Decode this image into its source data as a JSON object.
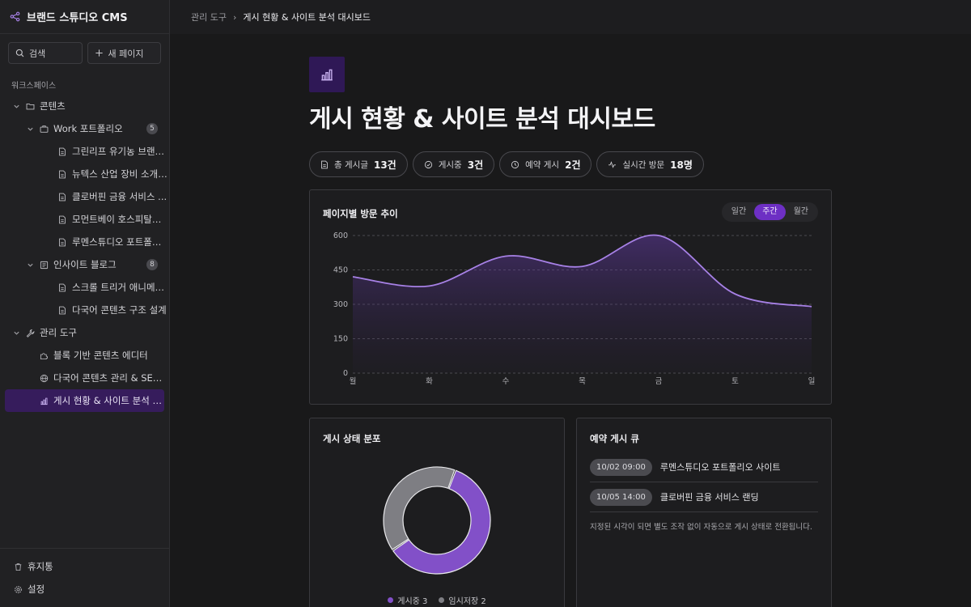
{
  "app": {
    "title": "브랜드 스튜디오 CMS"
  },
  "sidebar": {
    "search_label": "검색",
    "new_page_label": "새 페이지",
    "workspace_label": "워크스페이스",
    "tree": {
      "contents": {
        "label": "콘텐츠"
      },
      "work": {
        "label": "Work 포트폴리오",
        "count": "5",
        "items": [
          "그린리프 유기농 브랜드...",
          "뉴텍스 산업 장비 소개 ...",
          "클로버핀 금융 서비스 ...",
          "모먼트베이 호스피탈리...",
          "루멘스튜디오 포트폴리..."
        ]
      },
      "blog": {
        "label": "인사이트 블로그",
        "count": "8",
        "items": [
          "스크롤 트리거 애니메이...",
          "다국어 콘텐츠 구조 설계"
        ]
      },
      "admin": {
        "label": "관리 도구",
        "items": [
          "블록 기반 콘텐츠 에디터",
          "다국어 콘텐츠 관리 & SEO ...",
          "게시 현황 & 사이트 분석 대시..."
        ]
      }
    },
    "trash_label": "휴지통",
    "settings_label": "설정"
  },
  "breadcrumb": {
    "parent": "관리 도구",
    "separator": "›",
    "current": "게시 현황 & 사이트 분석 대시보드"
  },
  "page": {
    "title": "게시 현황 & 사이트 분석 대시보드"
  },
  "stats": [
    {
      "label": "총 게시글",
      "value": "13건",
      "icon": "document-icon"
    },
    {
      "label": "게시중",
      "value": "3건",
      "icon": "check-circle-icon"
    },
    {
      "label": "예약 게시",
      "value": "2건",
      "icon": "clock-icon"
    },
    {
      "label": "실시간 방문",
      "value": "18명",
      "icon": "activity-icon"
    }
  ],
  "visits": {
    "title": "페이지별 방문 추이",
    "ranges": [
      "일간",
      "주간",
      "월간"
    ],
    "active_range": "주간"
  },
  "status": {
    "title": "게시 상태 분포",
    "legend": [
      {
        "label": "게시중 3",
        "color": "#8250c8"
      },
      {
        "label": "임시저장 2",
        "color": "#7e7e83"
      }
    ]
  },
  "queue": {
    "title": "예약 게시 큐",
    "items": [
      {
        "time": "10/02 09:00",
        "title": "루멘스튜디오 포트폴리오 사이트"
      },
      {
        "time": "10/05 14:00",
        "title": "클로버핀 금융 서비스 랜딩"
      }
    ],
    "note": "지정된 시각이 되면 별도 조작 없이 자동으로 게시 상태로 전환됩니다."
  },
  "chart_data": [
    {
      "type": "area",
      "title": "페이지별 방문 추이",
      "categories": [
        "월",
        "화",
        "수",
        "목",
        "금",
        "토",
        "일"
      ],
      "values": [
        420,
        380,
        510,
        465,
        600,
        345,
        290
      ],
      "yticks": [
        0,
        150,
        300,
        450,
        600
      ],
      "ylim": [
        0,
        600
      ],
      "grid": true,
      "color": "#a781e6"
    },
    {
      "type": "pie",
      "title": "게시 상태 분포",
      "labels": [
        "게시중",
        "임시저장"
      ],
      "values": [
        3,
        2
      ],
      "colors": [
        "#8250c8",
        "#7e7e83"
      ],
      "donut": true
    }
  ]
}
